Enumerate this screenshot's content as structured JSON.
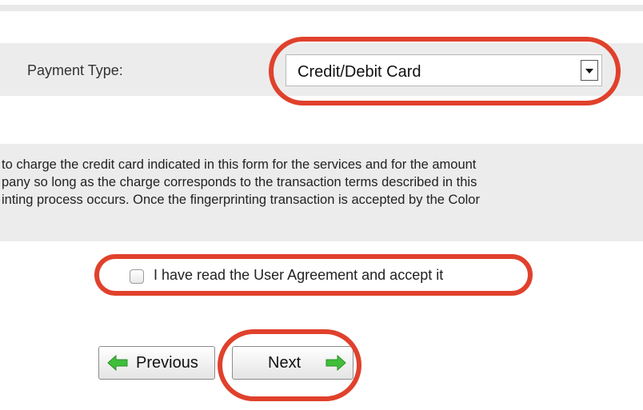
{
  "payment": {
    "label": "Payment Type:",
    "selected_value": "Credit/Debit Card"
  },
  "terms": {
    "lines": [
      " to charge the credit card indicated in this form for the services and for the amount",
      "pany so long as the charge corresponds to the transaction terms described in this",
      "inting process occurs. Once the fingerprinting transaction is accepted by the Color"
    ]
  },
  "agreement": {
    "checkbox_label": "I have read the User Agreement and accept it",
    "checked": false
  },
  "navigation": {
    "previous_label": "Previous",
    "next_label": "Next"
  },
  "colors": {
    "annotation": "#e0412c",
    "arrow_green": "#3fbf3a",
    "band_gray": "#ececec"
  },
  "icons": {
    "previous": "arrow-left-icon",
    "next": "arrow-right-icon"
  }
}
